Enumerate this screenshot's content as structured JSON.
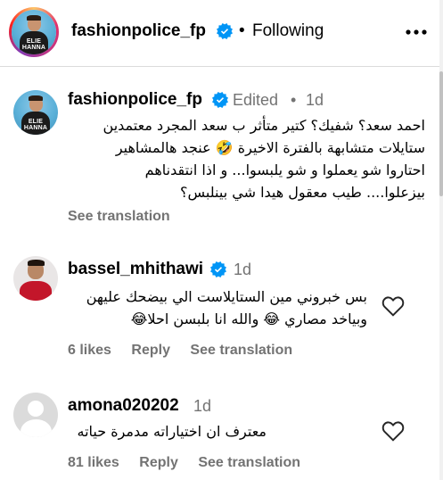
{
  "header": {
    "username": "fashionpolice_fp",
    "separator": "•",
    "follow_status": "Following",
    "avatar_tag": "ELIE HANNA"
  },
  "caption": {
    "username": "fashionpolice_fp",
    "edited_label": "Edited",
    "separator": "•",
    "time": "1d",
    "lines": [
      "احمد سعد؟ شفيك؟ كتير متأثر ب سعد المجرد معتمدين",
      "ستايلات متشابهة بالفترة الاخيرة 🤣 عنجد هالمشاهير",
      "احتاروا شو يعملوا و شو يلبسوا... و اذا انتقدناهم",
      "بيزعلوا.... طيب معقول هيدا شي بينلبس؟"
    ],
    "see_translation": "See translation"
  },
  "comments": [
    {
      "username": "bassel_mhithawi",
      "verified": true,
      "time": "1d",
      "lines": [
        "بس خبروني مين الستايلاست الي بيضحك عليهن",
        "وبياخد مصاري 😂 والله انا بلبسن احلا😂"
      ],
      "likes": "6 likes",
      "reply": "Reply",
      "see_translation": "See translation"
    },
    {
      "username": "amona020202",
      "verified": false,
      "time": "1d",
      "lines": [
        "معترف ان اختياراته مدمرة حياته"
      ],
      "likes": "81 likes",
      "reply": "Reply",
      "see_translation": "See translation"
    }
  ],
  "colors": {
    "verified_blue": "#0095f6",
    "meta_gray": "#737373",
    "divider": "#dbdbdb"
  },
  "icons": [
    "verified-badge-icon",
    "more-options-icon",
    "heart-icon"
  ]
}
